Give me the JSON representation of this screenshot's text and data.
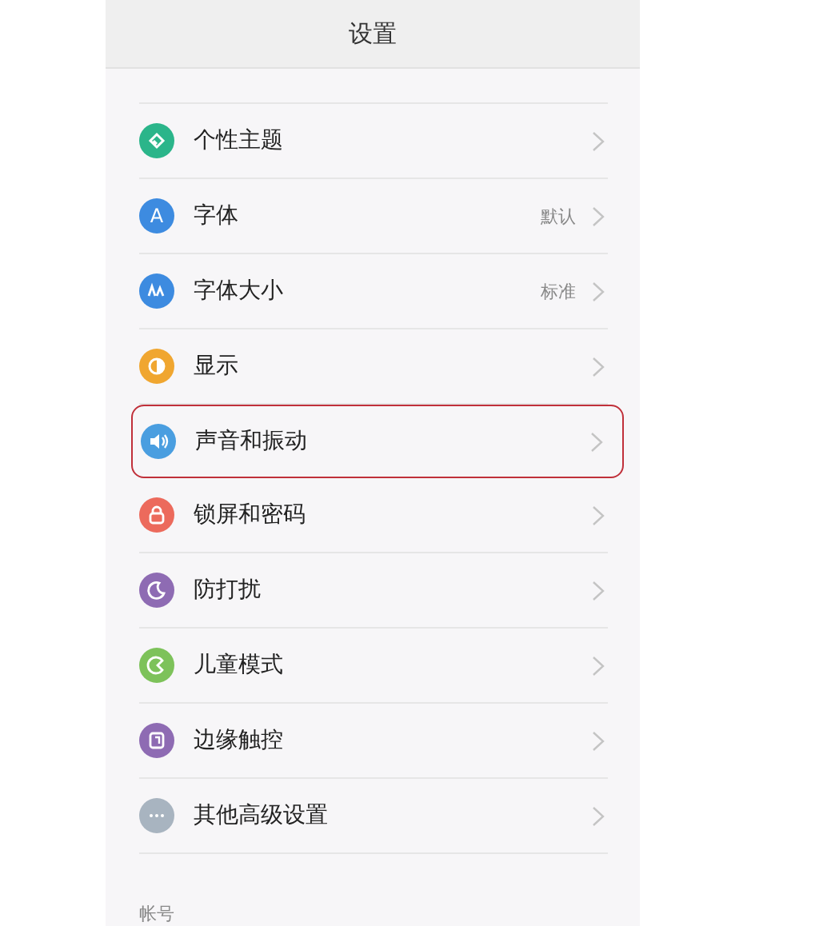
{
  "header": {
    "title": "设置"
  },
  "rows": [
    {
      "label": "个性主题",
      "color": "#2bb58a",
      "highlighted": false
    },
    {
      "label": "字体",
      "color": "#3d8be0",
      "glyph": "A",
      "value": "默认",
      "highlighted": false
    },
    {
      "label": "字体大小",
      "color": "#3d8be0",
      "value": "标准",
      "highlighted": false
    },
    {
      "label": "显示",
      "color": "#f0a630",
      "highlighted": false
    },
    {
      "label": "声音和振动",
      "color": "#4a9ee0",
      "highlighted": true
    },
    {
      "label": "锁屏和密码",
      "color": "#ec6a5c",
      "highlighted": false
    },
    {
      "label": "防打扰",
      "color": "#8e6bb3",
      "highlighted": false
    },
    {
      "label": "儿童模式",
      "color": "#7dc25a",
      "highlighted": false
    },
    {
      "label": "边缘触控",
      "color": "#8e6bb3",
      "highlighted": false
    },
    {
      "label": "其他高级设置",
      "color": "#a8b4c0",
      "highlighted": false
    }
  ],
  "section": {
    "label": "帐号"
  }
}
